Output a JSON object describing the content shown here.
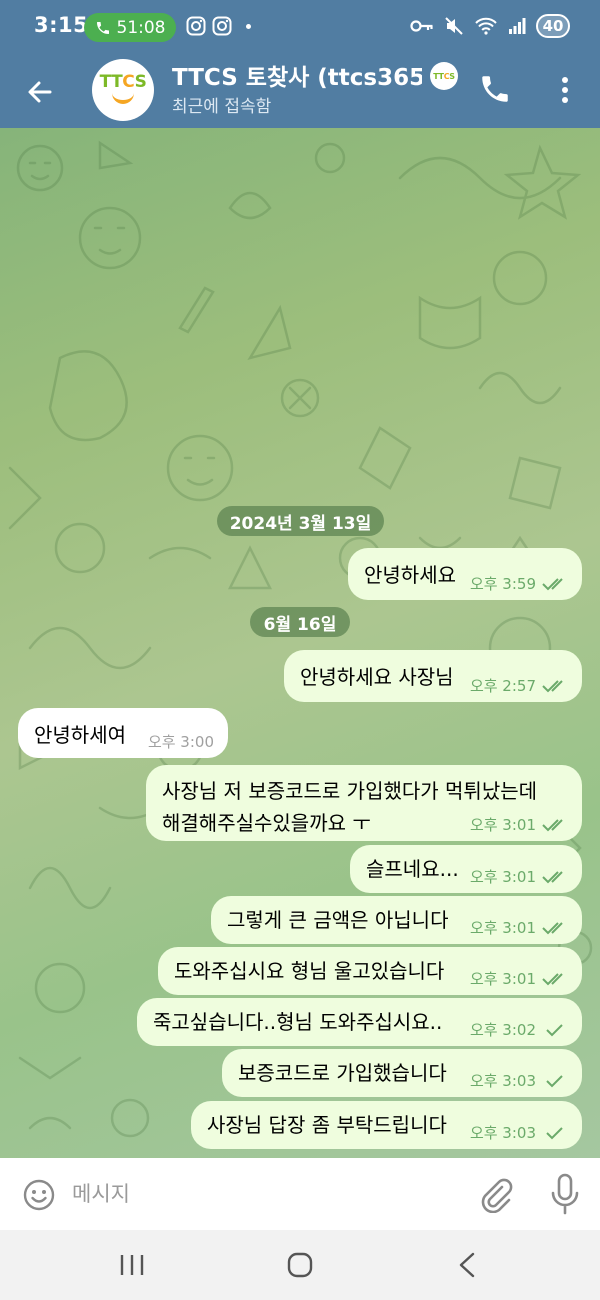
{
  "status_bar": {
    "time": "3:15",
    "call_duration": "51:08",
    "battery": "40",
    "icons": [
      "instagram-icon",
      "instagram-icon",
      "key-icon",
      "mute-icon",
      "wifi-icon",
      "signal-icon",
      "battery-icon"
    ]
  },
  "header": {
    "avatar_text_a": "TT",
    "avatar_text_b": "C",
    "avatar_text_c": "S",
    "title": "TTCS 토찾사 (ttcs365)",
    "subtitle": "최근에 접속함"
  },
  "dates": [
    {
      "label": "2024년 3월 13일"
    },
    {
      "label": "6월 16일"
    }
  ],
  "messages": [
    {
      "direction": "out",
      "text": "안녕하세요",
      "time": "오후 3:59",
      "read": true
    },
    {
      "direction": "out",
      "text": "안녕하세요 사장님",
      "time": "오후 2:57",
      "read": true
    },
    {
      "direction": "in",
      "text": "안녕하세여",
      "time": "오후 3:00"
    },
    {
      "direction": "out",
      "text": "사장님 저 보증코드로 가입했다가 먹튀났는데\n해결해주실수있을까요 ㅜ",
      "time": "오후 3:01",
      "read": true
    },
    {
      "direction": "out",
      "text": "슬프네요...",
      "time": "오후 3:01",
      "read": true
    },
    {
      "direction": "out",
      "text": "그렇게 큰 금액은 아닙니다",
      "time": "오후 3:01",
      "read": true
    },
    {
      "direction": "out",
      "text": "도와주십시요 형님 울고있습니다",
      "time": "오후 3:01",
      "read": true
    },
    {
      "direction": "out",
      "text": "죽고싶습니다..형님 도와주십시요..",
      "time": "오후 3:02",
      "read": false
    },
    {
      "direction": "out",
      "text": "보증코드로 가입했습니다",
      "time": "오후 3:03",
      "read": false
    },
    {
      "direction": "out",
      "text": "사장님 답장 좀 부탁드립니다",
      "time": "오후 3:03",
      "read": false
    }
  ],
  "input": {
    "placeholder": "메시지"
  },
  "colors": {
    "header": "#517DA2",
    "outgoing_bubble": "#EFFDDE",
    "incoming_bubble": "#FFFFFF",
    "tick": "#6BAA6A"
  }
}
